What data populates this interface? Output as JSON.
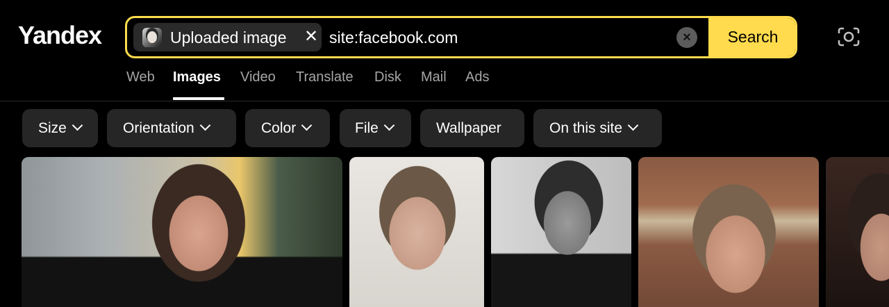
{
  "brand": {
    "logo_text": "Yandex"
  },
  "search": {
    "chip_label": "Uploaded image",
    "chip_close_icon": "close-icon",
    "query": "site:facebook.com",
    "clear_icon": "clear-circle-icon",
    "submit_label": "Search",
    "accent_color": "#ffdb4d"
  },
  "camera": {
    "icon": "camera-search-icon"
  },
  "tabs": [
    {
      "label": "Web",
      "active": false
    },
    {
      "label": "Images",
      "active": true
    },
    {
      "label": "Video",
      "active": false
    },
    {
      "label": "Translate",
      "active": false
    },
    {
      "label": "Disk",
      "active": false
    },
    {
      "label": "Mail",
      "active": false
    },
    {
      "label": "Ads",
      "active": false
    }
  ],
  "filters": [
    {
      "label": "Size",
      "has_dropdown": true
    },
    {
      "label": "Orientation",
      "has_dropdown": true
    },
    {
      "label": "Color",
      "has_dropdown": true
    },
    {
      "label": "File",
      "has_dropdown": true
    },
    {
      "label": "Wallpaper",
      "has_dropdown": false
    },
    {
      "label": "On this site",
      "has_dropdown": true
    }
  ],
  "results": {
    "count_visible": 5
  }
}
